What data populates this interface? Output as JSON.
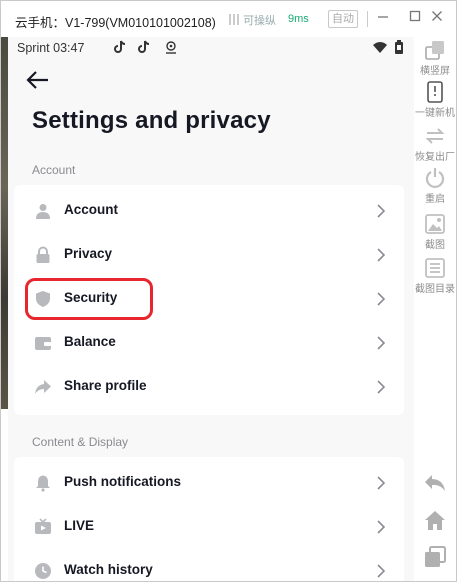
{
  "window": {
    "title": "云手机：V1-799(VM010101002108)",
    "control_label": "可操纵",
    "latency": "9ms",
    "auto_label": "自动"
  },
  "status_bar": {
    "carrier_time": "Sprint 03:47"
  },
  "page": {
    "title": "Settings and privacy"
  },
  "sections": {
    "account": {
      "title": "Account",
      "items": [
        {
          "label": "Account",
          "icon": "person-icon"
        },
        {
          "label": "Privacy",
          "icon": "lock-icon"
        },
        {
          "label": "Security",
          "icon": "shield-icon"
        },
        {
          "label": "Balance",
          "icon": "wallet-icon"
        },
        {
          "label": "Share profile",
          "icon": "share-icon"
        }
      ]
    },
    "content_display": {
      "title": "Content & Display",
      "items": [
        {
          "label": "Push notifications",
          "icon": "bell-icon"
        },
        {
          "label": "LIVE",
          "icon": "tv-icon"
        },
        {
          "label": "Watch history",
          "icon": "clock-icon"
        }
      ]
    }
  },
  "highlight": {
    "target": "Security",
    "color": "#e8262d"
  },
  "toolbar": {
    "items": [
      {
        "label": "横竖屏",
        "icon": "rotate-screen-icon"
      },
      {
        "label": "一键新机",
        "icon": "new-device-icon"
      },
      {
        "label": "恢复出厂",
        "icon": "factory-reset-icon"
      },
      {
        "label": "重启",
        "icon": "power-icon"
      },
      {
        "label": "截图",
        "icon": "screenshot-icon"
      },
      {
        "label": "截图目录",
        "icon": "screenshot-folder-icon"
      }
    ],
    "bottom": [
      {
        "icon": "back-icon"
      },
      {
        "icon": "home-icon"
      },
      {
        "icon": "recent-apps-icon"
      }
    ]
  },
  "colors": {
    "accent": "#161823",
    "secondary_text": "#8a8b91",
    "latency_green": "#19a974",
    "highlight_red": "#e8262d"
  }
}
